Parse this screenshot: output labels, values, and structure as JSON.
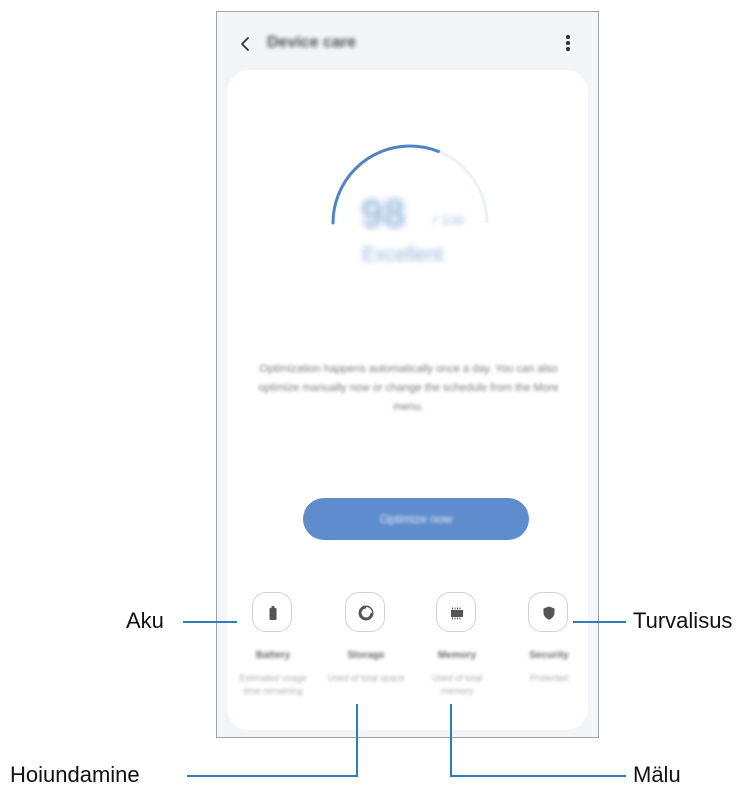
{
  "screen": {
    "title": "Device care",
    "score": "98",
    "score_unit": "/ 100",
    "status": "Excellent",
    "gauge_level_percent": 62,
    "info_text": "Optimization happens automatically once a day. You can also optimize manually now or change the schedule from the More menu.",
    "optimize_button": "Optimize now",
    "categories": [
      {
        "label": "Battery",
        "sub": "Estimated usage time remaining",
        "icon": "battery-icon"
      },
      {
        "label": "Storage",
        "sub": "Used of total space",
        "icon": "storage-icon"
      },
      {
        "label": "Memory",
        "sub": "Used of total memory",
        "icon": "memory-icon"
      },
      {
        "label": "Security",
        "sub": "Protected",
        "icon": "shield-icon"
      }
    ]
  },
  "callouts": {
    "aku": "Aku",
    "hoiundamine": "Hoiundamine",
    "malu": "Mälu",
    "turvalisus": "Turvalisus"
  },
  "colors": {
    "accent": "#4a84c6",
    "leader_line": "#2e7bbf"
  }
}
